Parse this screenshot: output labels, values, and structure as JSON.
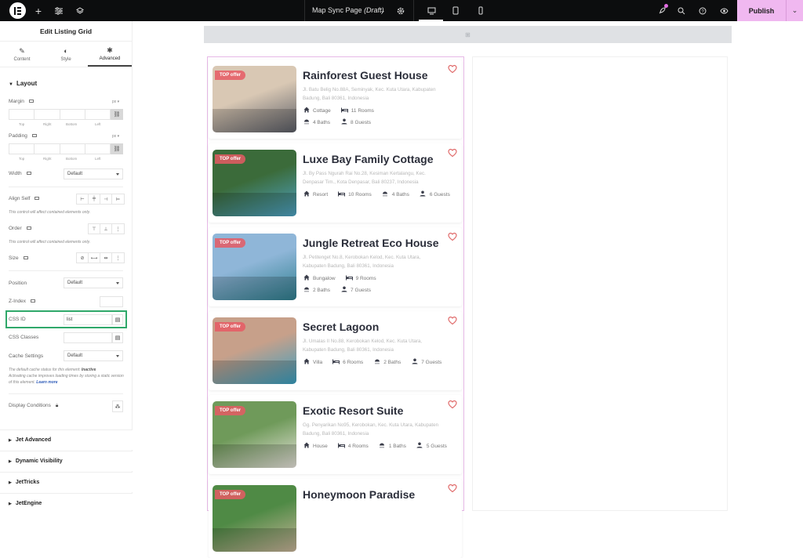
{
  "topbar": {
    "page_title": "Map Sync Page",
    "page_status": "(Draft)",
    "publish_label": "Publish",
    "icons": [
      "elementor-logo-icon",
      "plus-icon",
      "sliders-icon",
      "layers-icon",
      "chevron-down-icon",
      "gear-icon",
      "desktop-icon",
      "tablet-icon",
      "mobile-icon",
      "rocket-icon",
      "search-icon",
      "help-icon",
      "eye-icon",
      "chevron-down-icon"
    ]
  },
  "panel": {
    "title": "Edit Listing Grid",
    "tabs": [
      {
        "label": "Content",
        "icon": "pencil-icon"
      },
      {
        "label": "Style",
        "icon": "half-circle-icon"
      },
      {
        "label": "Advanced",
        "icon": "gear-icon",
        "active": true
      }
    ],
    "layout_title": "Layout",
    "margin_label": "Margin",
    "padding_label": "Padding",
    "unit": "px",
    "side_labels": [
      "Top",
      "Right",
      "Bottom",
      "Left"
    ],
    "width_label": "Width",
    "width_value": "Default",
    "align_self_label": "Align Self",
    "contained_note": "This control will affect contained elements only.",
    "order_label": "Order",
    "size_label": "Size",
    "position_label": "Position",
    "position_value": "Default",
    "zindex_label": "Z-Index",
    "zindex_value": "",
    "css_id_label": "CSS ID",
    "css_id_value": "list",
    "css_classes_label": "CSS Classes",
    "css_classes_value": "",
    "cache_label": "Cache Settings",
    "cache_value": "Default",
    "cache_note_prefix": "The default cache status for this element: ",
    "cache_note_status": "Inactive",
    "cache_note_body": "Activating cache improves loading times by storing a static version of this element. ",
    "cache_note_link": "Learn more",
    "display_conditions_label": "Display Conditions",
    "sections": [
      "Jet Advanced",
      "Dynamic Visibility",
      "JetTricks",
      "JetEngine"
    ]
  },
  "listings": [
    {
      "title": "Rainforest Guest House",
      "badge": "TOP offer",
      "address": "Jl. Batu Belig No.88A, Seminyak, Kec. Kuta Utara, Kabupaten Badung, Bali 80361, Indonesia",
      "type": "Cottage",
      "rooms": "11 Rooms",
      "baths": "4 Baths",
      "guests": "8 Guests",
      "wrap": true,
      "colors": [
        "#d9c8b4",
        "#5a5d66"
      ]
    },
    {
      "title": "Luxe Bay Family Cottage",
      "badge": "TOP offer",
      "address": "Jl. By Pass Ngurah Rai No.28, Kesiman Kertalangu, Kec. Denpasar Tim., Kota Denpasar, Bali 80237, Indonesia",
      "type": "Resort",
      "rooms": "10 Rooms",
      "baths": "4 Baths",
      "guests": "6 Guests",
      "wrap": false,
      "colors": [
        "#3b6b3a",
        "#4fa3c4"
      ]
    },
    {
      "title": "Jungle Retreat Eco House",
      "badge": "TOP offer",
      "address": "Jl. Petitenget No.8, Kerobokan Kelod, Kec. Kuta Utara, Kabupaten Badung, Bali 80361, Indonesia",
      "type": "Bungalow",
      "rooms": "9 Rooms",
      "baths": "2 Baths",
      "guests": "7 Guests",
      "wrap": true,
      "colors": [
        "#8fb6d8",
        "#2f7f8f"
      ]
    },
    {
      "title": "Secret Lagoon",
      "badge": "TOP offer",
      "address": "Jl. Umalas II No.88, Kerobokan Kelod, Kec. Kuta Utara, Kabupaten Badung, Bali 80361, Indonesia",
      "type": "Villa",
      "rooms": "6 Rooms",
      "baths": "2 Baths",
      "guests": "7 Guests",
      "wrap": false,
      "colors": [
        "#c7a08a",
        "#3aa0c2"
      ]
    },
    {
      "title": "Exotic Resort Suite",
      "badge": "TOP offer",
      "address": "Gg. Penyarikan No95, Kerobokan, Kec. Kuta Utara, Kabupaten Badung, Bali 80361, Indonesia",
      "type": "House",
      "rooms": "4 Rooms",
      "baths": "1 Baths",
      "guests": "5 Guests",
      "wrap": false,
      "colors": [
        "#6f9a5a",
        "#e8e4dc"
      ]
    },
    {
      "title": "Honeymoon Paradise",
      "badge": "TOP offer",
      "address": "",
      "type": "",
      "rooms": "",
      "baths": "",
      "guests": "",
      "wrap": false,
      "colors": [
        "#4f8a45",
        "#c9b59a"
      ]
    }
  ],
  "colors": {
    "accent": "#f0b8f0",
    "highlight": "#2fa86a",
    "heart": "#e06a6a",
    "title": "#2b2e3a"
  }
}
